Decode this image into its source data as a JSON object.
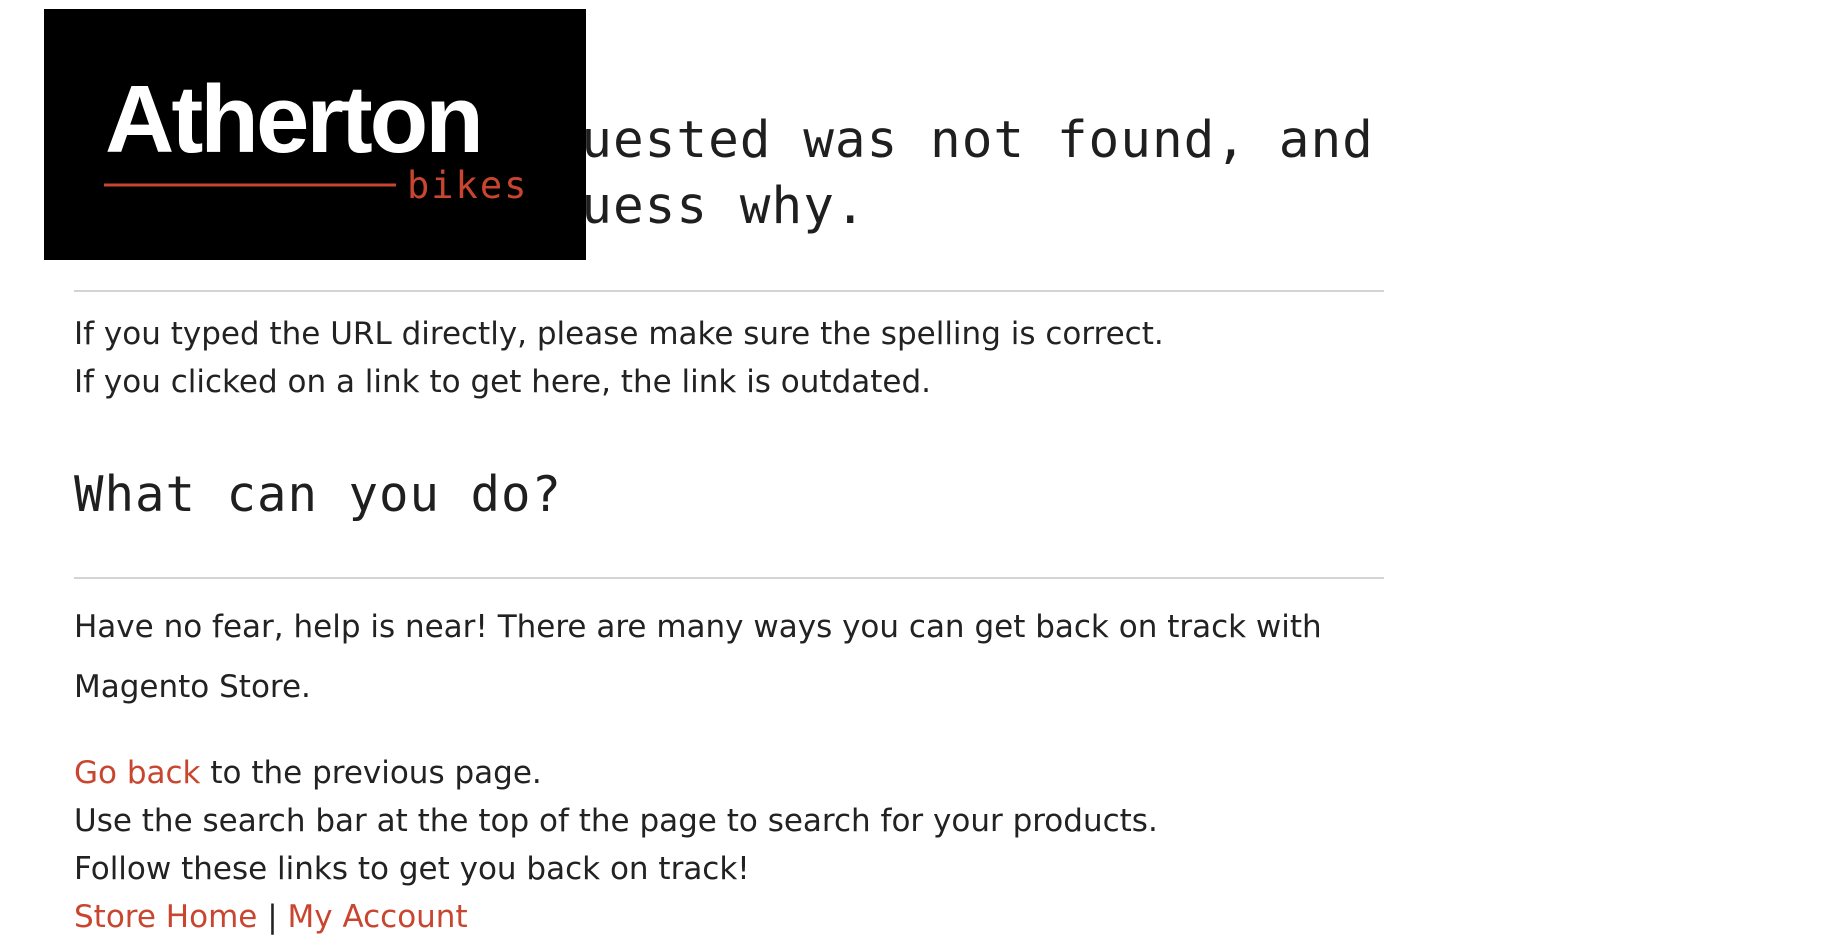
{
  "logo": {
    "brand": "Atherton",
    "sub": "bikes",
    "colors": {
      "background": "#000000",
      "text": "#ffffff",
      "accent": "#c8462f"
    }
  },
  "heading": {
    "line1": "The page you requested was not found, and",
    "line2": "we have a fine guess why."
  },
  "reasons": [
    "If you typed the URL directly, please make sure the spelling is correct.",
    "If you clicked on a link to get here, the link is outdated."
  ],
  "what_heading": "What can you do?",
  "help_text": "Have no fear, help is near! There are many ways you can get back on track with Magento Store.",
  "go_back": {
    "link_label": "Go back",
    "rest": " to the previous page."
  },
  "search_hint": "Use the search bar at the top of the page to search for your products.",
  "follow_text": "Follow these links to get you back on track!",
  "links": {
    "store_home": "Store Home",
    "separator": " | ",
    "my_account": "My Account"
  },
  "colors": {
    "link": "#c8462f",
    "text": "#222222",
    "rule": "#d4d4d4"
  }
}
